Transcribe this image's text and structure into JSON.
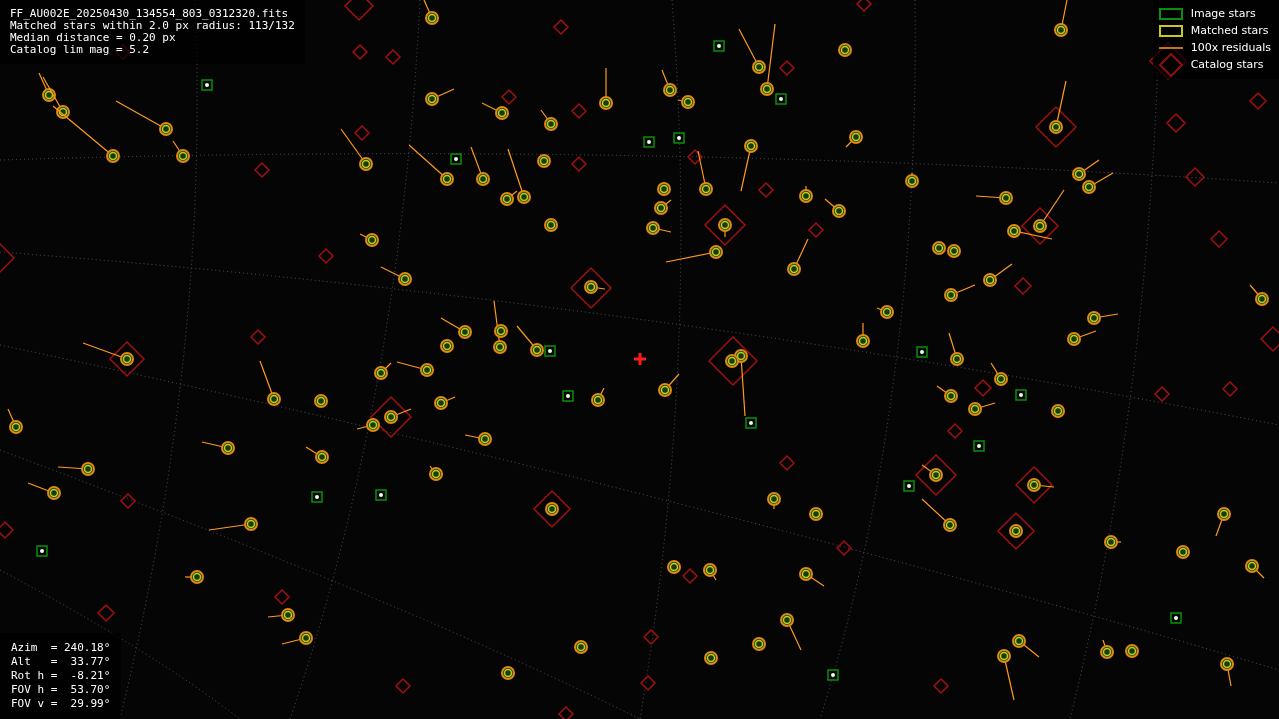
{
  "info_lines": [
    "FF_AU002E_20250430_134554_803_0312320.fits",
    "Matched stars within 2.0 px radius: 113/132",
    "Median distance = 0.20 px",
    "Catalog lim mag = 5.2"
  ],
  "legend": [
    {
      "kind": "image",
      "label": "Image stars"
    },
    {
      "kind": "matched",
      "label": "Matched stars"
    },
    {
      "kind": "residual",
      "label": "100x residuals"
    },
    {
      "kind": "catalog",
      "label": "Catalog stars"
    }
  ],
  "pointing_lines": [
    "Azim  = 240.18°",
    "Alt   =  33.77°",
    "Rot h =  -8.21°",
    "FOV h =  53.70°",
    "FOV v =  29.99°"
  ]
}
